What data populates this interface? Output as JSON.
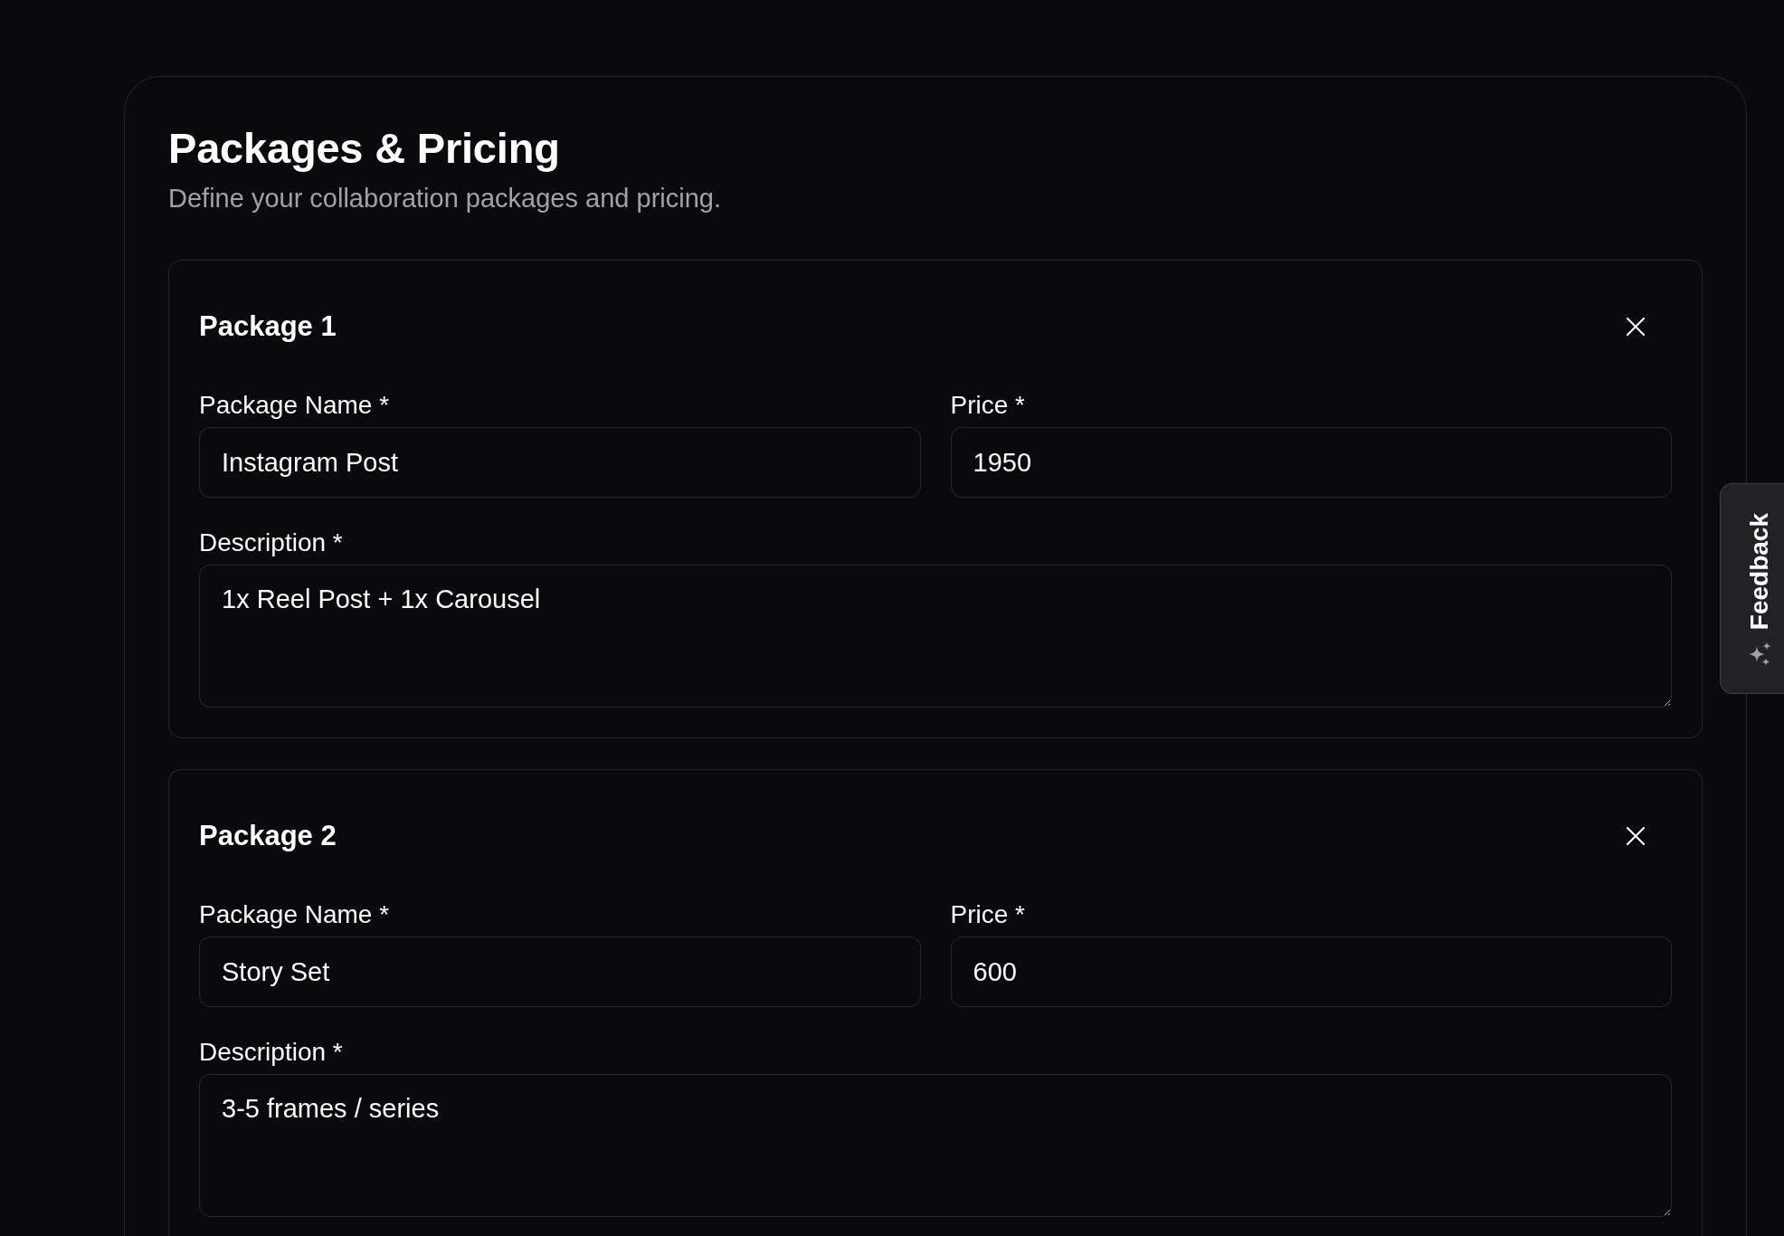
{
  "section": {
    "title": "Packages & Pricing",
    "subtitle": "Define your collaboration packages and pricing."
  },
  "packages": [
    {
      "title": "Package 1",
      "name_field": {
        "label": "Package Name *",
        "value": "Instagram Post"
      },
      "price_field": {
        "label": "Price *",
        "value": "1950"
      },
      "description_field": {
        "label": "Description *",
        "value": "1x Reel Post + 1x Carousel"
      }
    },
    {
      "title": "Package 2",
      "name_field": {
        "label": "Package Name *",
        "value": "Story Set"
      },
      "price_field": {
        "label": "Price *",
        "value": "600"
      },
      "description_field": {
        "label": "Description *",
        "value": "3-5 frames / series"
      }
    }
  ],
  "feedback_tab": {
    "label": "Feedback"
  }
}
